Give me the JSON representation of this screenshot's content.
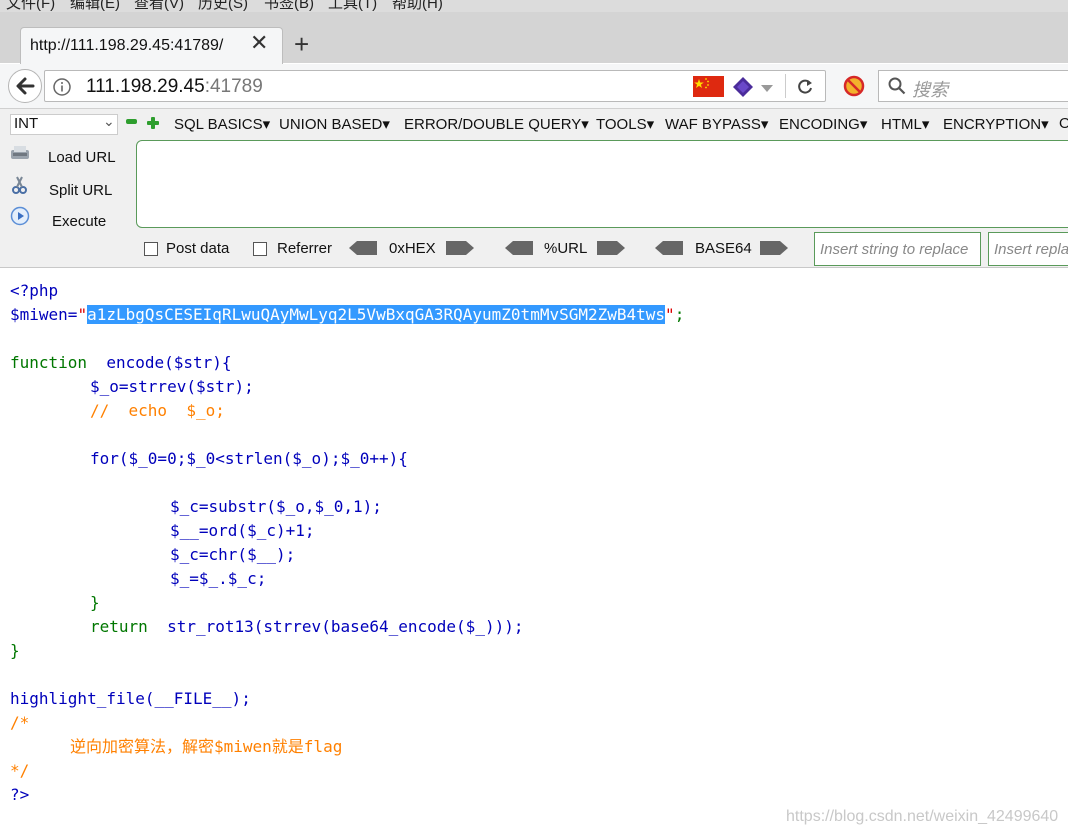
{
  "menubar": {
    "items": [
      "文件(F)",
      "编辑(E)",
      "查看(V)",
      "历史(S)",
      "书签(B)",
      "工具(T)",
      "帮助(H)"
    ]
  },
  "tab": {
    "title": "http://111.198.29.45:41789/",
    "close": "✕",
    "new": "+"
  },
  "nav": {
    "url_host": "111.198.29.45",
    "url_port": ":41789",
    "search_placeholder": "搜索"
  },
  "hackbar": {
    "type_select": "INT",
    "menus": [
      "SQL BASICS",
      "UNION BASED",
      "ERROR/DOUBLE QUERY",
      "TOOLS",
      "WAF BYPASS",
      "ENCODING",
      "HTML",
      "ENCRYPTION",
      "O"
    ],
    "load_url": "Load URL",
    "split_url": "Split URL",
    "execute": "Execute",
    "post_data": "Post data",
    "referrer": "Referrer",
    "hex": "0xHEX",
    "url": "%URL",
    "base64": "BASE64",
    "replace_placeholder": "Insert string to replace",
    "replace_with_placeholder": "Insert replacing string"
  },
  "code": {
    "l1": "<?php",
    "l2_var": "$miwen=",
    "l2_q": "\"",
    "l2_str": "a1zLbgQsCESEIqRLwuQAyMwLyq2L5VwBxqGA3RQAyumZ0tmMvSGM2ZwB4tws",
    "l2_end": ";",
    "l4a": "function",
    "l4b": "encode($str){",
    "l5": "$_o=strrev($str);",
    "l6": "//  echo  $_o;",
    "l8": "for($_0=0;$_0<strlen($_o);$_0++){",
    "l10": "$_c=substr($_o,$_0,1);",
    "l11": "$__=ord($_c)+1;",
    "l12": "$_c=chr($__);",
    "l13": "$_=$_.$_c;",
    "l14": "}",
    "l15a": "return",
    "l15b": "str_rot13(strrev(base64_encode($_)));",
    "l16": "}",
    "l18": "highlight_file(__FILE__);",
    "l19": "/*",
    "l20": "逆向加密算法，解密$miwen就是flag",
    "l21": "*/",
    "l22": "?>"
  },
  "watermark": "https://blog.csdn.net/weixin_42499640",
  "colors": {
    "keyword": "#007700",
    "var": "#0000bb",
    "comment": "#ff8000",
    "string": "#dd0000",
    "selection": "#3399ff"
  }
}
